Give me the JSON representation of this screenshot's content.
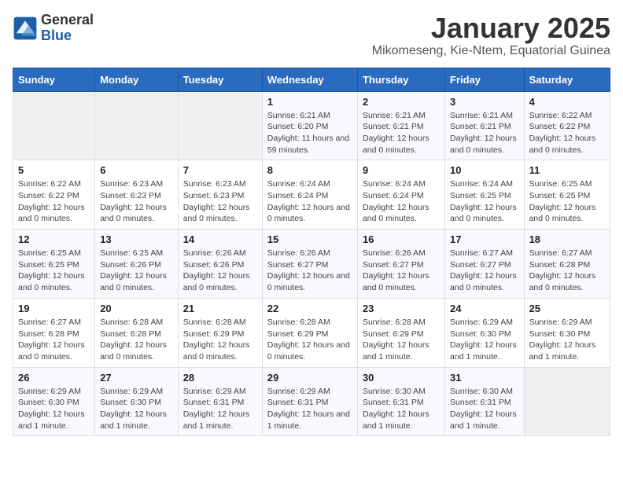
{
  "header": {
    "logo_line1": "General",
    "logo_line2": "Blue",
    "title": "January 2025",
    "subtitle": "Mikomeseng, Kie-Ntem, Equatorial Guinea"
  },
  "days_of_week": [
    "Sunday",
    "Monday",
    "Tuesday",
    "Wednesday",
    "Thursday",
    "Friday",
    "Saturday"
  ],
  "weeks": [
    [
      {
        "day": "",
        "info": ""
      },
      {
        "day": "",
        "info": ""
      },
      {
        "day": "",
        "info": ""
      },
      {
        "day": "1",
        "info": "Sunrise: 6:21 AM\nSunset: 6:20 PM\nDaylight: 11 hours and 59 minutes."
      },
      {
        "day": "2",
        "info": "Sunrise: 6:21 AM\nSunset: 6:21 PM\nDaylight: 12 hours and 0 minutes."
      },
      {
        "day": "3",
        "info": "Sunrise: 6:21 AM\nSunset: 6:21 PM\nDaylight: 12 hours and 0 minutes."
      },
      {
        "day": "4",
        "info": "Sunrise: 6:22 AM\nSunset: 6:22 PM\nDaylight: 12 hours and 0 minutes."
      }
    ],
    [
      {
        "day": "5",
        "info": "Sunrise: 6:22 AM\nSunset: 6:22 PM\nDaylight: 12 hours and 0 minutes."
      },
      {
        "day": "6",
        "info": "Sunrise: 6:23 AM\nSunset: 6:23 PM\nDaylight: 12 hours and 0 minutes."
      },
      {
        "day": "7",
        "info": "Sunrise: 6:23 AM\nSunset: 6:23 PM\nDaylight: 12 hours and 0 minutes."
      },
      {
        "day": "8",
        "info": "Sunrise: 6:24 AM\nSunset: 6:24 PM\nDaylight: 12 hours and 0 minutes."
      },
      {
        "day": "9",
        "info": "Sunrise: 6:24 AM\nSunset: 6:24 PM\nDaylight: 12 hours and 0 minutes."
      },
      {
        "day": "10",
        "info": "Sunrise: 6:24 AM\nSunset: 6:25 PM\nDaylight: 12 hours and 0 minutes."
      },
      {
        "day": "11",
        "info": "Sunrise: 6:25 AM\nSunset: 6:25 PM\nDaylight: 12 hours and 0 minutes."
      }
    ],
    [
      {
        "day": "12",
        "info": "Sunrise: 6:25 AM\nSunset: 6:25 PM\nDaylight: 12 hours and 0 minutes."
      },
      {
        "day": "13",
        "info": "Sunrise: 6:25 AM\nSunset: 6:26 PM\nDaylight: 12 hours and 0 minutes."
      },
      {
        "day": "14",
        "info": "Sunrise: 6:26 AM\nSunset: 6:26 PM\nDaylight: 12 hours and 0 minutes."
      },
      {
        "day": "15",
        "info": "Sunrise: 6:26 AM\nSunset: 6:27 PM\nDaylight: 12 hours and 0 minutes."
      },
      {
        "day": "16",
        "info": "Sunrise: 6:26 AM\nSunset: 6:27 PM\nDaylight: 12 hours and 0 minutes."
      },
      {
        "day": "17",
        "info": "Sunrise: 6:27 AM\nSunset: 6:27 PM\nDaylight: 12 hours and 0 minutes."
      },
      {
        "day": "18",
        "info": "Sunrise: 6:27 AM\nSunset: 6:28 PM\nDaylight: 12 hours and 0 minutes."
      }
    ],
    [
      {
        "day": "19",
        "info": "Sunrise: 6:27 AM\nSunset: 6:28 PM\nDaylight: 12 hours and 0 minutes."
      },
      {
        "day": "20",
        "info": "Sunrise: 6:28 AM\nSunset: 6:28 PM\nDaylight: 12 hours and 0 minutes."
      },
      {
        "day": "21",
        "info": "Sunrise: 6:28 AM\nSunset: 6:29 PM\nDaylight: 12 hours and 0 minutes."
      },
      {
        "day": "22",
        "info": "Sunrise: 6:28 AM\nSunset: 6:29 PM\nDaylight: 12 hours and 0 minutes."
      },
      {
        "day": "23",
        "info": "Sunrise: 6:28 AM\nSunset: 6:29 PM\nDaylight: 12 hours and 1 minute."
      },
      {
        "day": "24",
        "info": "Sunrise: 6:29 AM\nSunset: 6:30 PM\nDaylight: 12 hours and 1 minute."
      },
      {
        "day": "25",
        "info": "Sunrise: 6:29 AM\nSunset: 6:30 PM\nDaylight: 12 hours and 1 minute."
      }
    ],
    [
      {
        "day": "26",
        "info": "Sunrise: 6:29 AM\nSunset: 6:30 PM\nDaylight: 12 hours and 1 minute."
      },
      {
        "day": "27",
        "info": "Sunrise: 6:29 AM\nSunset: 6:30 PM\nDaylight: 12 hours and 1 minute."
      },
      {
        "day": "28",
        "info": "Sunrise: 6:29 AM\nSunset: 6:31 PM\nDaylight: 12 hours and 1 minute."
      },
      {
        "day": "29",
        "info": "Sunrise: 6:29 AM\nSunset: 6:31 PM\nDaylight: 12 hours and 1 minute."
      },
      {
        "day": "30",
        "info": "Sunrise: 6:30 AM\nSunset: 6:31 PM\nDaylight: 12 hours and 1 minute."
      },
      {
        "day": "31",
        "info": "Sunrise: 6:30 AM\nSunset: 6:31 PM\nDaylight: 12 hours and 1 minute."
      },
      {
        "day": "",
        "info": ""
      }
    ]
  ]
}
